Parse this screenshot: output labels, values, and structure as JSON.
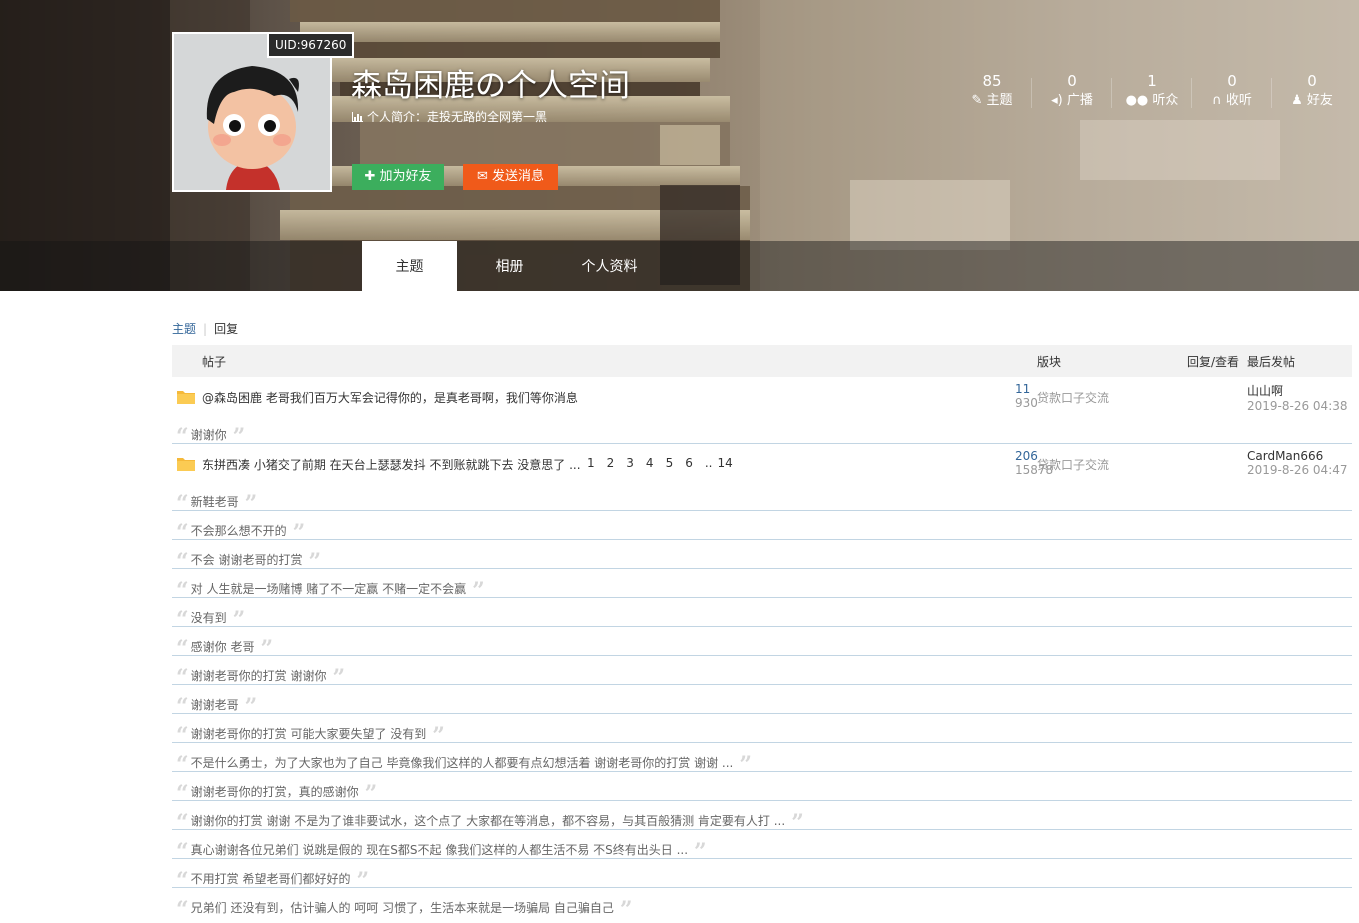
{
  "profile": {
    "uid": "UID:967260",
    "title": "森岛困鹿の个人空间",
    "intro": "个人简介：走投无路的全网第一黑",
    "add_friend": "加为好友",
    "send_message": "发送消息"
  },
  "stats": [
    {
      "num": "85",
      "label": "主题",
      "icon": "pencil-icon"
    },
    {
      "num": "0",
      "label": "广播",
      "icon": "speaker-icon"
    },
    {
      "num": "1",
      "label": "听众",
      "icon": "group-icon"
    },
    {
      "num": "0",
      "label": "收听",
      "icon": "headphones-icon"
    },
    {
      "num": "0",
      "label": "好友",
      "icon": "user-icon"
    }
  ],
  "nav": [
    "主题",
    "相册",
    "个人资料"
  ],
  "subtabs": {
    "topic": "主题",
    "reply": "回复"
  },
  "table_header": {
    "post": "帖子",
    "forum": "版块",
    "reply_view": "回复/查看",
    "last_post": "最后发帖"
  },
  "threads": [
    {
      "title": "@森岛困鹿 老哥我们百万大军会记得你的，是真老哥啊，我们等你消息",
      "forum": "贷款口子交流",
      "replies": "11",
      "views": "930",
      "last_user": "山山啊",
      "last_date": "2019-8-26 04:38",
      "pages": [],
      "quotes": [
        "谢谢你"
      ]
    },
    {
      "title": "东拼西凑 小猪交了前期 在天台上瑟瑟发抖 不到账就跳下去 没意思了 ...",
      "forum": "贷款口子交流",
      "replies": "206",
      "views": "15878",
      "last_user": "CardMan666",
      "last_date": "2019-8-26 04:47",
      "pages": [
        "1",
        "2",
        "3",
        "4",
        "5",
        "6",
        "..",
        "14"
      ],
      "quotes": [
        "新鞋老哥",
        "不会那么想不开的",
        "不会 谢谢老哥的打赏",
        "对 人生就是一场赌博 赌了不一定赢 不赌一定不会赢",
        "没有到",
        "感谢你 老哥",
        "谢谢老哥你的打赏 谢谢你",
        "谢谢老哥",
        "谢谢老哥你的打赏 可能大家要失望了 没有到",
        "不是什么勇士，为了大家也为了自己 毕竟像我们这样的人都要有点幻想活着 谢谢老哥你的打赏 谢谢 ...",
        "谢谢老哥你的打赏，真的感谢你",
        "谢谢你的打赏 谢谢 不是为了谁非要试水，这个点了 大家都在等消息，都不容易，与其百般猜测 肯定要有人打 ...",
        "真心谢谢各位兄弟们 说跳是假的 现在S都S不起 像我们这样的人都生活不易 不S终有出头日 ...",
        "不用打赏 希望老哥们都好好的",
        "兄弟们 还没有到，估计骗人的 呵呵 习惯了，生活本来就是一场骗局 自己骗自己"
      ]
    }
  ],
  "colors": {
    "add_friend": "#3cae5d",
    "send_message": "#f05a1a",
    "link": "#336699",
    "row_border": "#c2d5e3"
  }
}
